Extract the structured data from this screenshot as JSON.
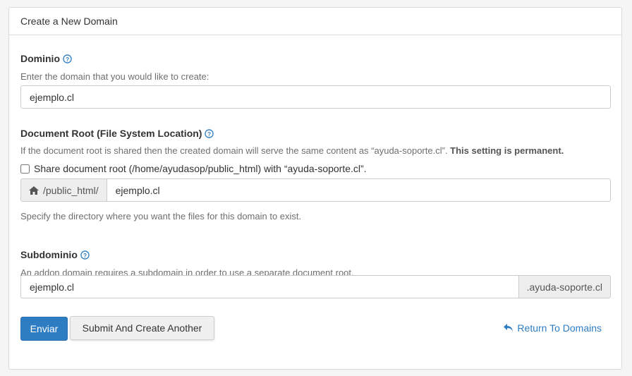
{
  "panel": {
    "title": "Create a New Domain"
  },
  "domain": {
    "label": "Dominio",
    "help": "Enter the domain that you would like to create:",
    "value": "ejemplo.cl"
  },
  "docroot": {
    "label": "Document Root (File System Location)",
    "help_text": "If the document root is shared then the created domain will serve the same content as “ayuda-soporte.cl”.",
    "help_bold": "This setting is permanent.",
    "share_label": "Share document root (/home/ayudasop/public_html) with “ayuda-soporte.cl”.",
    "share_checked": false,
    "prefix": "/public_html/",
    "value": "ejemplo.cl",
    "hint": "Specify the directory where you want the files for this domain to exist."
  },
  "subdomain": {
    "label": "Subdominio",
    "help": "An addon domain requires a subdomain in order to use a separate document root.",
    "value": "ejemplo.cl",
    "suffix": ".ayuda-soporte.cl"
  },
  "actions": {
    "submit": "Enviar",
    "submit_another": "Submit And Create Another",
    "return": "Return To Domains"
  },
  "colors": {
    "primary": "#2e7dc3",
    "link": "#2e7dc3",
    "annotation_arrow": "#e0161b"
  },
  "icons": {
    "help": "question-circle-icon",
    "home": "home-icon",
    "return": "undo-arrow-icon"
  }
}
